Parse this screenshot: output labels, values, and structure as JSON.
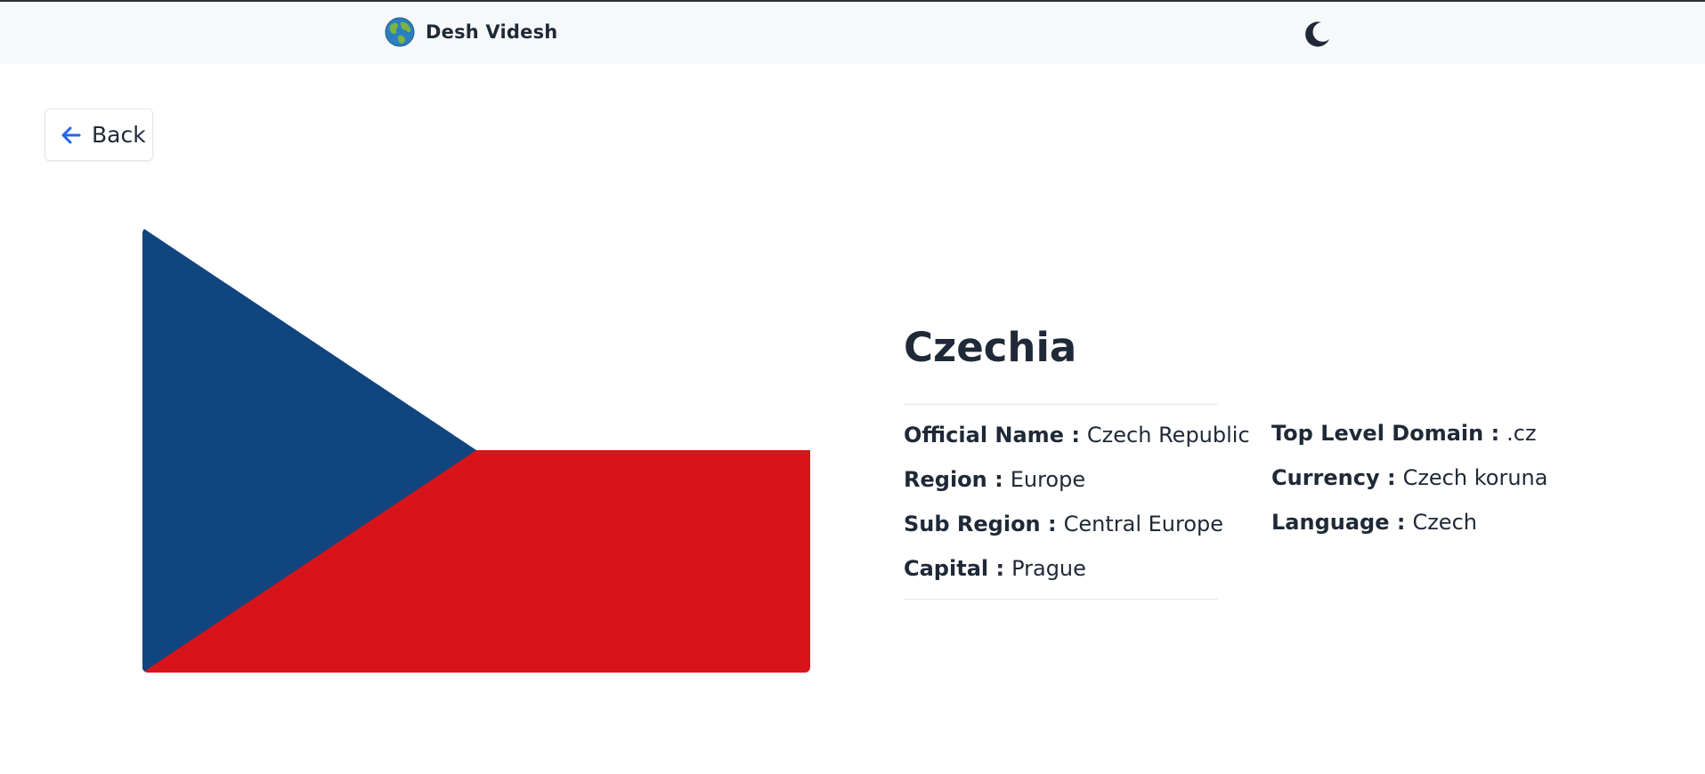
{
  "navbar": {
    "brand_name": "Desh Videsh",
    "brand_icon": "globe-icon",
    "theme_toggle_icon": "moon-icon"
  },
  "back_button": {
    "label": "Back",
    "icon": "arrow-left-icon"
  },
  "country": {
    "name": "Czechia",
    "flag": {
      "colors": {
        "blue": "#11457e",
        "white": "#ffffff",
        "red": "#d7141a"
      }
    }
  },
  "details_left": [
    {
      "key": "Official Name :",
      "value": "Czech Republic"
    },
    {
      "key": "Region :",
      "value": "Europe"
    },
    {
      "key": "Sub Region :",
      "value": "Central Europe"
    },
    {
      "key": "Capital :",
      "value": "Prague"
    }
  ],
  "details_right": [
    {
      "key": "Top Level Domain :",
      "value": ".cz"
    },
    {
      "key": "Currency :",
      "value": "Czech koruna"
    },
    {
      "key": "Language :",
      "value": "Czech"
    }
  ],
  "colors": {
    "text": "#1f2937",
    "accent_arrow": "#2563eb",
    "navbar_bg": "#f7f8f9"
  }
}
